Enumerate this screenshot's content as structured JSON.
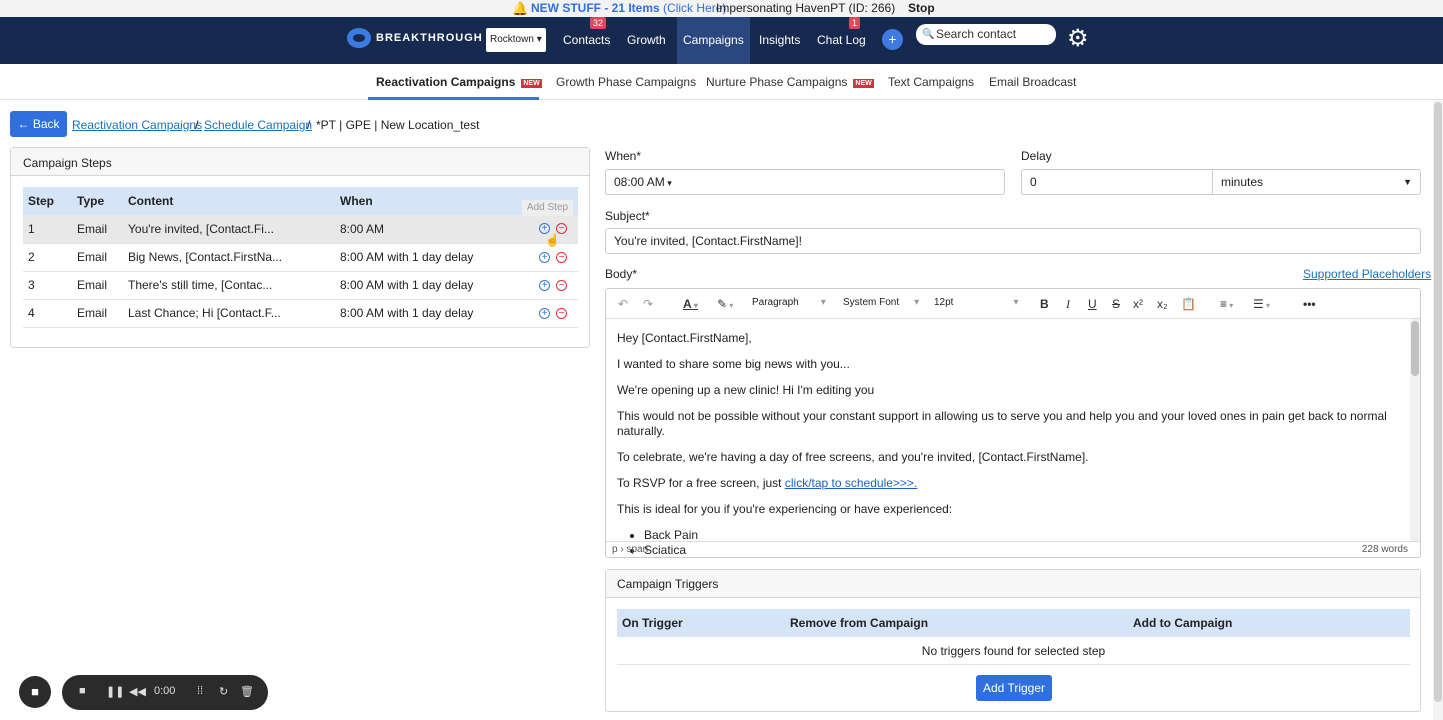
{
  "announcement": {
    "new_stuff": "NEW STUFF - 21 Items",
    "click_here": "(Click Here)",
    "impersonating": "Impersonating HavenPT (ID: 266)",
    "stop": "Stop"
  },
  "header": {
    "logo": "BREAKTHROUGH",
    "location": "Rocktown",
    "nav": [
      {
        "label": "Contacts",
        "badge": "32"
      },
      {
        "label": "Growth",
        "badge": ""
      },
      {
        "label": "Campaigns",
        "badge": ""
      },
      {
        "label": "Insights",
        "badge": ""
      },
      {
        "label": "Chat Log",
        "badge": "1"
      }
    ],
    "add": "+",
    "search_placeholder": "Search contact"
  },
  "subnav": {
    "items": [
      "Reactivation Campaigns",
      "Growth Phase Campaigns",
      "Nurture Phase Campaigns",
      "Text Campaigns",
      "Email Broadcast"
    ],
    "new_tag": "NEW"
  },
  "breadcrumb": {
    "back": "← Back",
    "items": [
      "Reactivation Campaigns",
      "Schedule Campaign",
      "*PT | GPE | New Location_test"
    ],
    "sep": "/"
  },
  "steps": {
    "title": "Campaign Steps",
    "columns": [
      "Step",
      "Type",
      "Content",
      "When"
    ],
    "tooltip": "Add Step",
    "rows": [
      {
        "step": "1",
        "type": "Email",
        "content": "You're invited, [Contact.Fi...",
        "when": "8:00 AM"
      },
      {
        "step": "2",
        "type": "Email",
        "content": "Big News, [Contact.FirstNa...",
        "when": "8:00 AM with 1 day delay"
      },
      {
        "step": "3",
        "type": "Email",
        "content": "There's still time, [Contac...",
        "when": "8:00 AM with 1 day delay"
      },
      {
        "step": "4",
        "type": "Email",
        "content": "Last Chance; Hi [Contact.F...",
        "when": "8:00 AM with 1 day delay"
      }
    ]
  },
  "form": {
    "when_label": "When*",
    "when_value": "08:00  AM",
    "delay_label": "Delay",
    "delay_value": "0",
    "delay_unit": "minutes",
    "subject_label": "Subject*",
    "subject_value": "You're invited, [Contact.FirstName]!",
    "body_label": "Body*",
    "placeholders_link": "Supported Placeholders"
  },
  "editor": {
    "paragraph": "Paragraph",
    "font": "System Font",
    "size": "12pt",
    "lines": [
      "Hey [Contact.FirstName],",
      "I wanted to share some big news with you...",
      "We're opening up a new clinic! Hi I'm editing you",
      "This would not be possible without your constant support in allowing us to serve you and help you and your loved ones in pain get back to normal naturally.",
      "To celebrate, we're having a day of free screens, and you're invited, [Contact.FirstName].",
      "To RSVP for a free screen, just ",
      "This is ideal for you if you're experiencing or have experienced:"
    ],
    "rsvp_link": "click/tap to schedule>>>.",
    "bullets": [
      "Back Pain",
      "Sciatica"
    ],
    "path": "p › span",
    "words": "228 words"
  },
  "triggers": {
    "title": "Campaign Triggers",
    "columns": [
      "On Trigger",
      "Remove from Campaign",
      "Add to Campaign"
    ],
    "empty": "No triggers found for selected step",
    "add_button": "Add Trigger"
  },
  "recorder": {
    "time": "0:00"
  }
}
